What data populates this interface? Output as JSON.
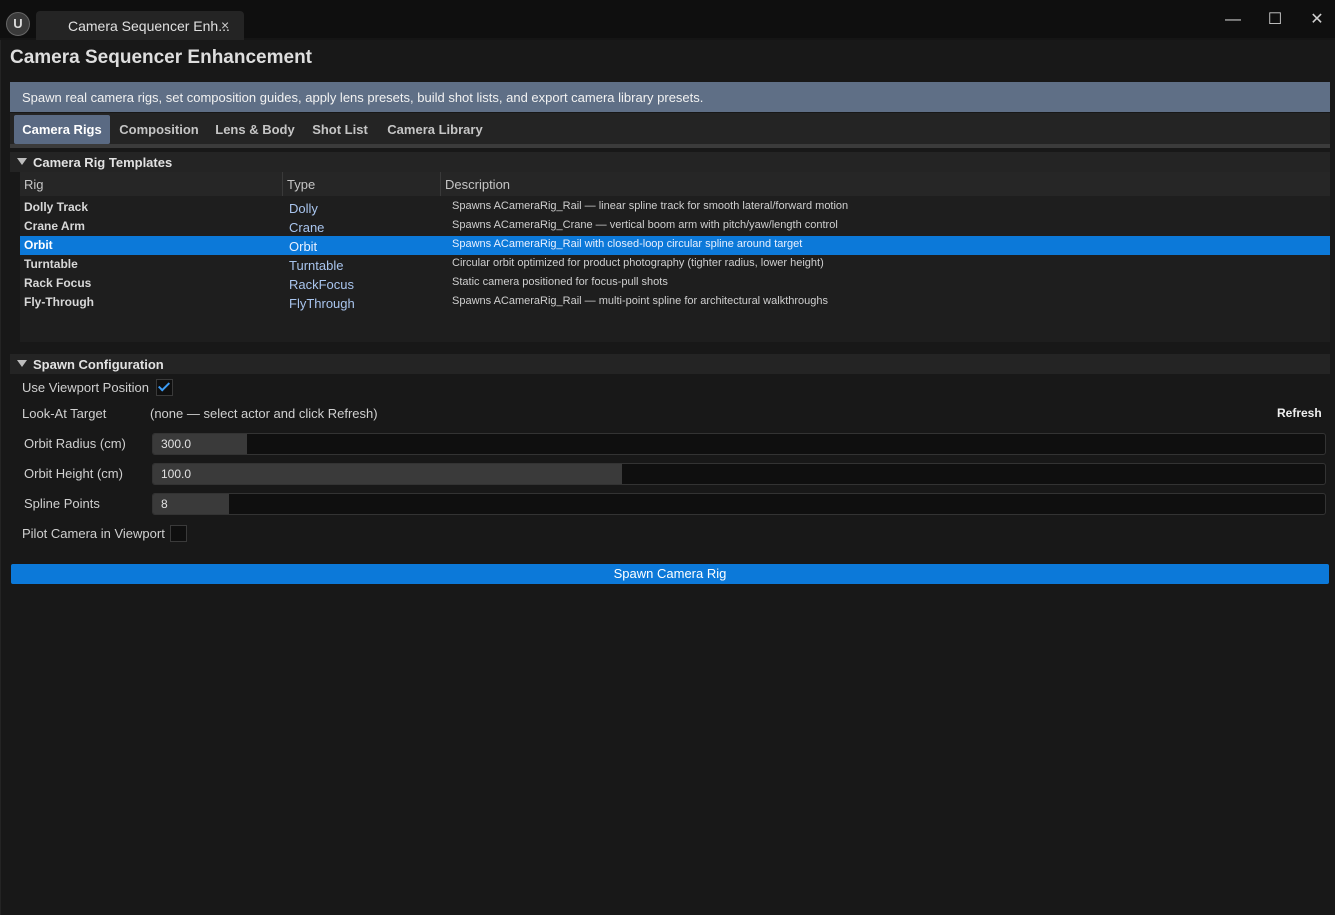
{
  "window": {
    "tab_title": "Camera Sequencer Enh...",
    "close_tab_glyph": "×",
    "minimize_glyph": "—",
    "maximize_glyph": "☐",
    "close_glyph": "✕",
    "logo_glyph": "U"
  },
  "app": {
    "title": "Camera Sequencer Enhancement",
    "banner": "Spawn real camera rigs, set composition guides, apply lens presets, build shot lists, and export camera library presets."
  },
  "tabs": [
    {
      "label": "Camera Rigs",
      "active": true
    },
    {
      "label": "Composition",
      "active": false
    },
    {
      "label": "Lens & Body",
      "active": false
    },
    {
      "label": "Shot List",
      "active": false
    },
    {
      "label": "Camera Library",
      "active": false
    }
  ],
  "templates": {
    "section_label": "Camera Rig Templates",
    "columns": [
      "Rig",
      "Type",
      "Description"
    ],
    "rows": [
      {
        "rig": "Dolly Track",
        "type": "Dolly",
        "description": "Spawns ACameraRig_Rail — linear spline track for smooth lateral/forward motion"
      },
      {
        "rig": "Crane Arm",
        "type": "Crane",
        "description": "Spawns ACameraRig_Crane — vertical boom arm with pitch/yaw/length control"
      },
      {
        "rig": "Orbit",
        "type": "Orbit",
        "description": "Spawns ACameraRig_Rail with closed-loop circular spline around target"
      },
      {
        "rig": "Turntable",
        "type": "Turntable",
        "description": "Circular orbit optimized for product photography (tighter radius, lower height)"
      },
      {
        "rig": "Rack Focus",
        "type": "RackFocus",
        "description": "Static camera positioned for focus-pull shots"
      },
      {
        "rig": "Fly-Through",
        "type": "FlyThrough",
        "description": "Spawns ACameraRig_Rail — multi-point spline for architectural walkthroughs"
      }
    ],
    "selected_row": "Orbit"
  },
  "spawn": {
    "section_label": "Spawn Configuration",
    "use_viewport_label": "Use Viewport Position",
    "use_viewport_checked": true,
    "look_at_label": "Look-At Target",
    "look_at_value": "(none — select actor and click Refresh)",
    "refresh_label": "Refresh",
    "orbit_radius_label": "Orbit Radius (cm)",
    "orbit_radius_value": "300.0",
    "orbit_radius_fill": 0.08,
    "orbit_height_label": "Orbit Height (cm)",
    "orbit_height_value": "100.0",
    "orbit_height_fill": 0.4,
    "spline_points_label": "Spline Points",
    "spline_points_value": "8",
    "spline_points_fill": 0.065,
    "pilot_label": "Pilot Camera in Viewport",
    "pilot_checked": false,
    "spawn_button_label": "Spawn Camera Rig"
  },
  "colors": {
    "accent": "#0c79d9",
    "banner": "#5f6f86",
    "active_tab": "#5a6a83",
    "background": "#181818"
  }
}
